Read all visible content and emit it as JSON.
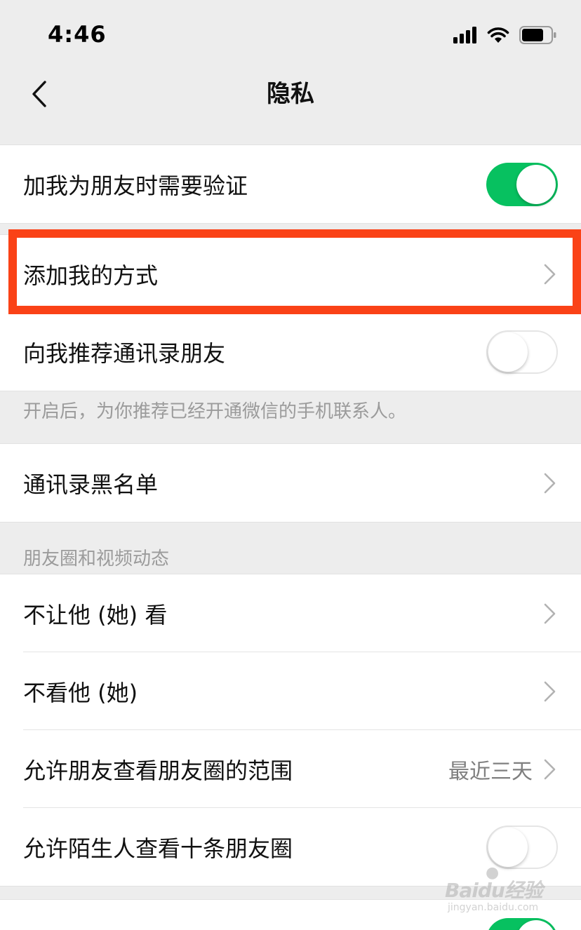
{
  "status_bar": {
    "time": "4:46"
  },
  "nav": {
    "title": "隐私"
  },
  "settings": {
    "verify": {
      "label": "加我为朋友时需要验证",
      "state": "on"
    },
    "add_methods": {
      "label": "添加我的方式"
    },
    "recommend": {
      "label": "向我推荐通讯录朋友",
      "state": "off"
    },
    "recommend_note": "开启后，为你推荐已经开通微信的手机联系人。",
    "blacklist": {
      "label": "通讯录黑名单"
    },
    "moments_header": "朋友圈和视频动态",
    "hide_from": {
      "label": "不让他 (她) 看"
    },
    "dont_see": {
      "label": "不看他 (她)"
    },
    "range": {
      "label": "允许朋友查看朋友圈的范围",
      "value": "最近三天"
    },
    "strangers": {
      "label": "允许陌生人查看十条朋友圈",
      "state": "off"
    },
    "next_row": {
      "state": "on"
    }
  },
  "colors": {
    "toggle_on": "#07c160",
    "highlight": "#fa4217",
    "background": "#ededed"
  },
  "icons": [
    "back-chevron-icon",
    "chevron-right-icon",
    "signal-icon",
    "wifi-icon",
    "battery-icon"
  ],
  "watermark": {
    "main": "Baidu经验",
    "sub": "jingyan.baidu.com"
  }
}
